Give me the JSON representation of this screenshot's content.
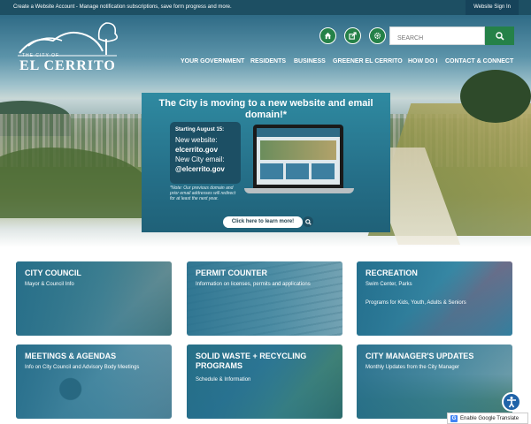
{
  "topbar": {
    "left_text": "Create a Website Account - Manage notification subscriptions, save form progress and more.",
    "right_text": "Website Sign In"
  },
  "logo": {
    "small": "THE CITY OF",
    "big": "EL CERRITO"
  },
  "header_icons": [
    "home-icon",
    "share-icon",
    "gear-icon"
  ],
  "search": {
    "placeholder": "SEARCH",
    "button_icon": "search-icon"
  },
  "nav": [
    "YOUR GOVERNMENT",
    "RESIDENTS",
    "BUSINESS",
    "GREENER EL CERRITO",
    "HOW DO I",
    "CONTACT & CONNECT"
  ],
  "promo": {
    "title": "The City is moving to a new website and email domain!*",
    "starting": "Starting August 15:",
    "new_website_label": "New website:",
    "new_website": "elcerrito.gov",
    "new_email_label": "New City email:",
    "new_email": "@elcerrito.gov",
    "note": "*Note: Our previous domain and prior email addresses will redirect for at least the next year.",
    "cta": "Click here to learn more!"
  },
  "cards": [
    {
      "title": "CITY COUNCIL",
      "desc": "Mayor & Council Info",
      "desc2": ""
    },
    {
      "title": "PERMIT COUNTER",
      "desc": "Information on licenses, permits and applications",
      "desc2": ""
    },
    {
      "title": "RECREATION",
      "desc": "Swim Center, Parks",
      "desc2": "Programs for Kids, Youth, Adults & Seniors"
    },
    {
      "title": "MEETINGS & AGENDAS",
      "desc": "Info on City Council and Advisory Body Meetings",
      "desc2": ""
    },
    {
      "title": "SOLID WASTE + RECYCLING PROGRAMS",
      "desc": "Schedule & Information",
      "desc2": ""
    },
    {
      "title": "CITY MANAGER'S UPDATES",
      "desc": "Monthly Updates from the City Manager",
      "desc2": ""
    }
  ],
  "translate": {
    "label": "Enable Google Translate"
  },
  "colors": {
    "accent_green": "#258148",
    "top_bar": "#1d4f63",
    "card_overlay": "#2a7a96"
  }
}
